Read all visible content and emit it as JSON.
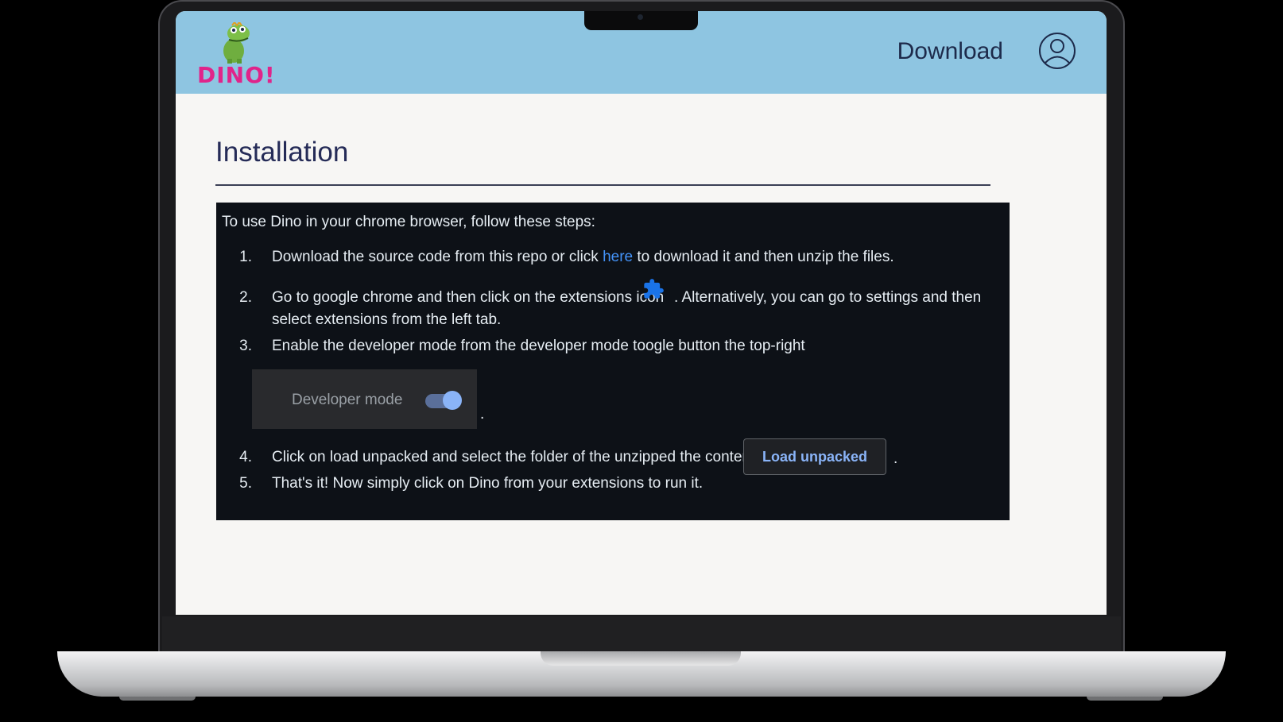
{
  "site": {
    "logo_text": "DINO!",
    "nav_download": "Download"
  },
  "page": {
    "title": "Installation"
  },
  "instructions": {
    "intro": "To use Dino in your chrome browser, follow these steps:",
    "steps": [
      {
        "num": "1.",
        "before": "Download the source code from this repo or click ",
        "link": "here",
        "after": " to download it and then unzip the files."
      },
      {
        "num": "2.",
        "before": "Go to google chrome and then click on the extensions icon",
        "after": ". Alternatively, you can go to settings and then",
        "line2": "select extensions from the left tab."
      },
      {
        "num": "3.",
        "text": "Enable the developer mode from the developer mode toogle button the top-right"
      },
      {
        "num": "4.",
        "text": "Click on load unpacked and select the folder of the unzipped the content"
      },
      {
        "num": "5.",
        "text": "That's it! Now simply click on Dino from your extensions to run it."
      }
    ],
    "developer_mode_label": "Developer mode",
    "developer_mode_on": true,
    "load_unpacked_label": "Load unpacked",
    "period": "."
  },
  "colors": {
    "header_bg": "#8ec5e1",
    "logo": "#e0248a",
    "link": "#4493f8",
    "panel_bg": "#0d1117"
  },
  "icons": [
    "dino-logo-icon",
    "user-avatar-icon",
    "puzzle-extension-icon",
    "toggle-switch-icon"
  ]
}
